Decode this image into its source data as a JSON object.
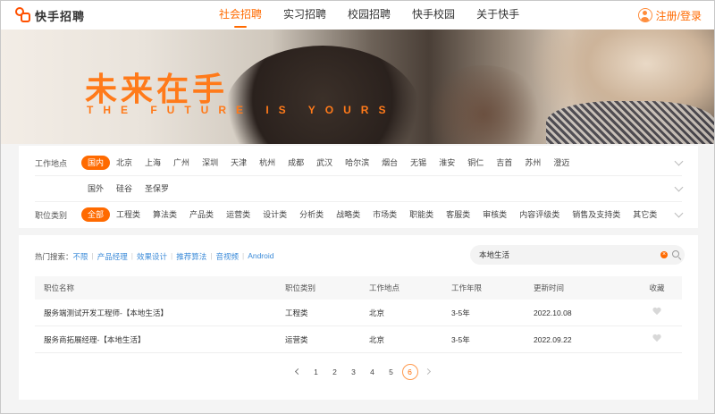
{
  "header": {
    "logo_text": "快手招聘",
    "nav": [
      {
        "label": "社会招聘",
        "active": true
      },
      {
        "label": "实习招聘",
        "active": false
      },
      {
        "label": "校园招聘",
        "active": false
      },
      {
        "label": "快手校园",
        "active": false
      },
      {
        "label": "关于快手",
        "active": false
      }
    ],
    "login_label": "注册/登录"
  },
  "banner": {
    "title": "未来在手",
    "subtitle": "THE FUTURE IS YOURS"
  },
  "filters": {
    "location_label": "工作地点",
    "locations": [
      "国内",
      "北京",
      "上海",
      "广州",
      "深圳",
      "天津",
      "杭州",
      "成都",
      "武汉",
      "哈尔滨",
      "烟台",
      "无锡",
      "淮安",
      "铜仁",
      "吉首",
      "苏州",
      "澄迈"
    ],
    "locations_row2": [
      "国外",
      "硅谷",
      "圣保罗"
    ],
    "category_label": "职位类别",
    "categories": [
      "全部",
      "工程类",
      "算法类",
      "产品类",
      "运营类",
      "设计类",
      "分析类",
      "战略类",
      "市场类",
      "职能类",
      "客服类",
      "审核类",
      "内容评级类",
      "销售及支持类",
      "其它类"
    ]
  },
  "jobs": {
    "hot_label": "热门搜索：",
    "hot_keywords": [
      "不限",
      "产品经理",
      "效果设计",
      "推荐算法",
      "音视频",
      "Android"
    ],
    "search_value": "本地生活",
    "columns": [
      "职位名称",
      "职位类别",
      "工作地点",
      "工作年限",
      "更新时间",
      "收藏"
    ],
    "rows": [
      {
        "title": "服务端测试开发工程师-【本地生活】",
        "category": "工程类",
        "location": "北京",
        "years": "3-5年",
        "updated": "2022.10.08"
      },
      {
        "title": "服务商拓展经理-【本地生活】",
        "category": "运营类",
        "location": "北京",
        "years": "3-5年",
        "updated": "2022.09.22"
      }
    ],
    "pages": [
      "1",
      "2",
      "3",
      "4",
      "5",
      "6"
    ],
    "current_page": "6"
  },
  "colors": {
    "accent": "#ff6a00",
    "link": "#3a8ad8"
  }
}
